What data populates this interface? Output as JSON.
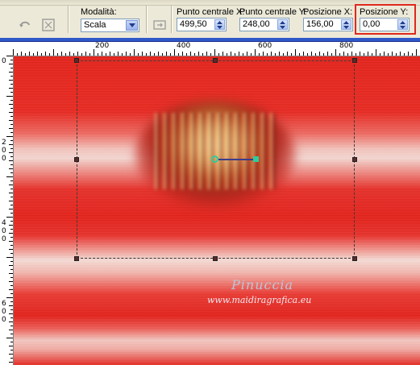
{
  "toolbar": {
    "mode": {
      "label": "Modalità:",
      "value": "Scala"
    },
    "center_x": {
      "label": "Punto centrale X:",
      "value": "499,50"
    },
    "center_y": {
      "label": "Punto centrale Y:",
      "value": "248,00"
    },
    "pos_x": {
      "label": "Posizione X:",
      "value": "156,00"
    },
    "pos_y": {
      "label": "Posizione Y:",
      "value": "0,00"
    }
  },
  "rulers": {
    "horizontal": [
      "200",
      "400",
      "600",
      "800"
    ],
    "vertical": [
      "0",
      "2",
      "0",
      "0",
      "4",
      "0",
      "0",
      "6",
      "0",
      "0"
    ]
  },
  "canvas": {
    "signature": "Pinuccia",
    "url": "www.maidiragrafica.eu"
  },
  "colors": {
    "highlight": "#e0281e",
    "title_bar": "#2f59c9",
    "canvas_red": "#e4221b"
  },
  "icons": {
    "undo": "reset-icon",
    "transform": "transform-icon",
    "presets": "presets-icon"
  }
}
